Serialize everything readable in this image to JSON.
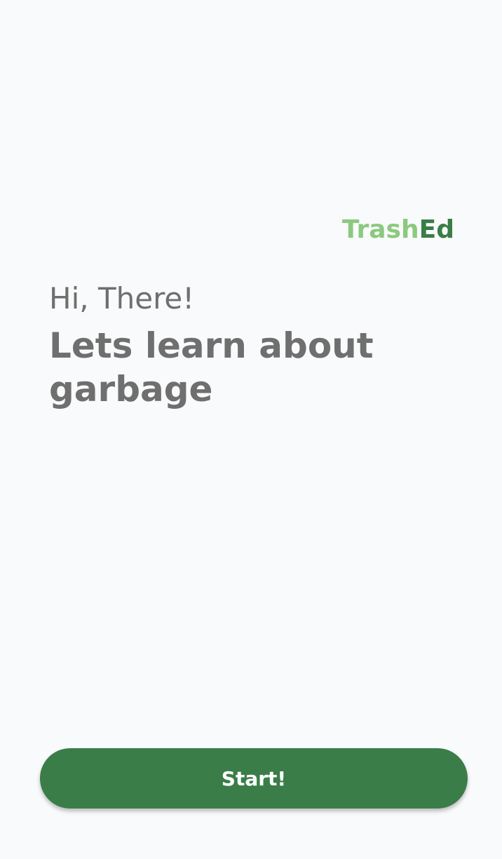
{
  "brand": {
    "name_part1": "Trash",
    "name_part2": "Ed",
    "color_light": "#8cc97e",
    "color_dark": "#3a7d48"
  },
  "intro": {
    "greeting": "Hi, There!",
    "headline": "Lets learn about garbage"
  },
  "actions": {
    "start_label": "Start!"
  },
  "colors": {
    "background": "#f9fafb",
    "text": "#6f6f6f",
    "accent": "#3a7d48"
  }
}
